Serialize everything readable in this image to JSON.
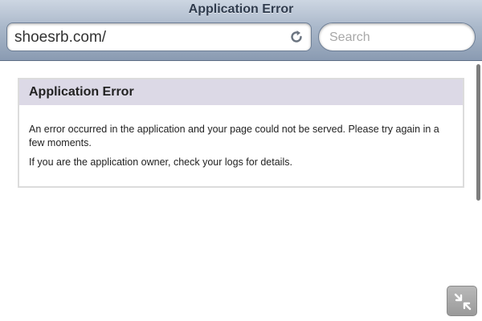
{
  "window": {
    "title": "Application Error"
  },
  "toolbar": {
    "url": "shoesrb.com/",
    "reload_icon": "reload-icon",
    "search_placeholder": "Search"
  },
  "page": {
    "heading": "Application Error",
    "message": "An error occurred in the application and your page could not be served. Please try again in a few moments.",
    "owner_hint": "If you are the application owner, check your logs for details."
  },
  "controls": {
    "fullscreen_icon": "collapse-arrows-icon"
  }
}
